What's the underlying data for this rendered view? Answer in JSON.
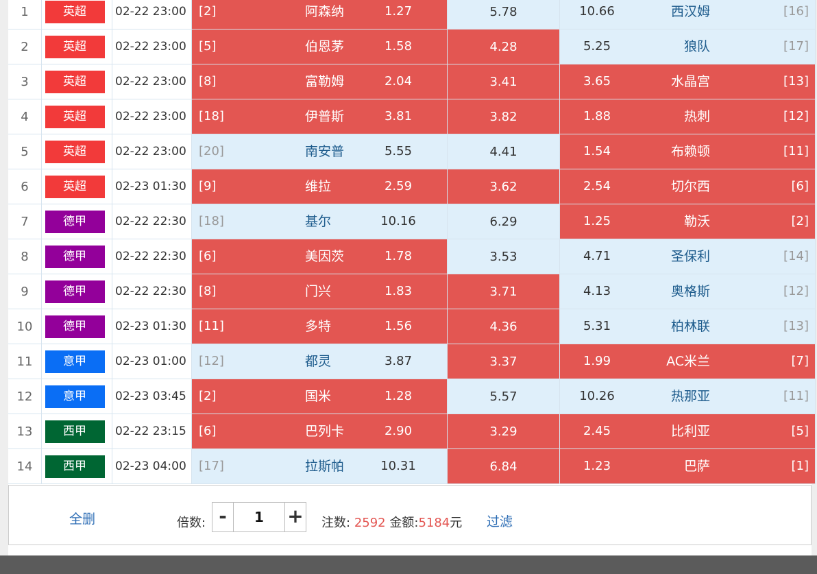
{
  "colors": {
    "selected_bg": "#e35652",
    "unselected_bg": "#dfeffa",
    "league_epl": "#f23a3a",
    "league_bundesliga": "#93009a",
    "league_serie_a": "#0a6ef5",
    "league_laliga": "#006633"
  },
  "matches": [
    {
      "no": "1",
      "league": "英超",
      "league_color": "#f23a3a",
      "time": "02-22 23:00",
      "home_rank": "[2]",
      "home": "阿森纳",
      "home_odds": "1.27",
      "draw_odds": "5.78",
      "away_odds": "10.66",
      "away": "西汉姆",
      "away_rank": "[16]",
      "sel": [
        true,
        false,
        false
      ]
    },
    {
      "no": "2",
      "league": "英超",
      "league_color": "#f23a3a",
      "time": "02-22 23:00",
      "home_rank": "[5]",
      "home": "伯恩茅",
      "home_odds": "1.58",
      "draw_odds": "4.28",
      "away_odds": "5.25",
      "away": "狼队",
      "away_rank": "[17]",
      "sel": [
        true,
        true,
        false
      ]
    },
    {
      "no": "3",
      "league": "英超",
      "league_color": "#f23a3a",
      "time": "02-22 23:00",
      "home_rank": "[8]",
      "home": "富勒姆",
      "home_odds": "2.04",
      "draw_odds": "3.41",
      "away_odds": "3.65",
      "away": "水晶宫",
      "away_rank": "[13]",
      "sel": [
        true,
        true,
        true
      ]
    },
    {
      "no": "4",
      "league": "英超",
      "league_color": "#f23a3a",
      "time": "02-22 23:00",
      "home_rank": "[18]",
      "home": "伊普斯",
      "home_odds": "3.81",
      "draw_odds": "3.82",
      "away_odds": "1.88",
      "away": "热刺",
      "away_rank": "[12]",
      "sel": [
        true,
        true,
        true
      ]
    },
    {
      "no": "5",
      "league": "英超",
      "league_color": "#f23a3a",
      "time": "02-22 23:00",
      "home_rank": "[20]",
      "home": "南安普",
      "home_odds": "5.55",
      "draw_odds": "4.41",
      "away_odds": "1.54",
      "away": "布赖顿",
      "away_rank": "[11]",
      "sel": [
        false,
        false,
        true
      ]
    },
    {
      "no": "6",
      "league": "英超",
      "league_color": "#f23a3a",
      "time": "02-23 01:30",
      "home_rank": "[9]",
      "home": "维拉",
      "home_odds": "2.59",
      "draw_odds": "3.62",
      "away_odds": "2.54",
      "away": "切尔西",
      "away_rank": "[6]",
      "sel": [
        true,
        true,
        true
      ]
    },
    {
      "no": "7",
      "league": "德甲",
      "league_color": "#93009a",
      "time": "02-22 22:30",
      "home_rank": "[18]",
      "home": "基尔",
      "home_odds": "10.16",
      "draw_odds": "6.29",
      "away_odds": "1.25",
      "away": "勒沃",
      "away_rank": "[2]",
      "sel": [
        false,
        false,
        true
      ]
    },
    {
      "no": "8",
      "league": "德甲",
      "league_color": "#93009a",
      "time": "02-22 22:30",
      "home_rank": "[6]",
      "home": "美因茨",
      "home_odds": "1.78",
      "draw_odds": "3.53",
      "away_odds": "4.71",
      "away": "圣保利",
      "away_rank": "[14]",
      "sel": [
        true,
        false,
        false
      ]
    },
    {
      "no": "9",
      "league": "德甲",
      "league_color": "#93009a",
      "time": "02-22 22:30",
      "home_rank": "[8]",
      "home": "门兴",
      "home_odds": "1.83",
      "draw_odds": "3.71",
      "away_odds": "4.13",
      "away": "奥格斯",
      "away_rank": "[12]",
      "sel": [
        true,
        true,
        false
      ]
    },
    {
      "no": "10",
      "league": "德甲",
      "league_color": "#93009a",
      "time": "02-23 01:30",
      "home_rank": "[11]",
      "home": "多特",
      "home_odds": "1.56",
      "draw_odds": "4.36",
      "away_odds": "5.31",
      "away": "柏林联",
      "away_rank": "[13]",
      "sel": [
        true,
        true,
        false
      ]
    },
    {
      "no": "11",
      "league": "意甲",
      "league_color": "#0a6ef5",
      "time": "02-23 01:00",
      "home_rank": "[12]",
      "home": "都灵",
      "home_odds": "3.87",
      "draw_odds": "3.37",
      "away_odds": "1.99",
      "away": "AC米兰",
      "away_rank": "[7]",
      "sel": [
        false,
        true,
        true
      ]
    },
    {
      "no": "12",
      "league": "意甲",
      "league_color": "#0a6ef5",
      "time": "02-23 03:45",
      "home_rank": "[2]",
      "home": "国米",
      "home_odds": "1.28",
      "draw_odds": "5.57",
      "away_odds": "10.26",
      "away": "热那亚",
      "away_rank": "[11]",
      "sel": [
        true,
        false,
        false
      ]
    },
    {
      "no": "13",
      "league": "西甲",
      "league_color": "#006633",
      "time": "02-22 23:15",
      "home_rank": "[6]",
      "home": "巴列卡",
      "home_odds": "2.90",
      "draw_odds": "3.29",
      "away_odds": "2.45",
      "away": "比利亚",
      "away_rank": "[5]",
      "sel": [
        true,
        true,
        true
      ]
    },
    {
      "no": "14",
      "league": "西甲",
      "league_color": "#006633",
      "time": "02-23 04:00",
      "home_rank": "[17]",
      "home": "拉斯帕",
      "home_odds": "10.31",
      "draw_odds": "6.84",
      "away_odds": "1.23",
      "away": "巴萨",
      "away_rank": "[1]",
      "sel": [
        false,
        true,
        true
      ]
    }
  ],
  "footer": {
    "delete_all": "全删",
    "multiplier_label": "倍数:",
    "minus": "-",
    "multiplier_value": "1",
    "plus": "+",
    "bets_label": "注数:",
    "bets_value": "2592",
    "amount_label": "金额:",
    "amount_value": "5184",
    "amount_unit": "元",
    "filter": "过滤"
  }
}
